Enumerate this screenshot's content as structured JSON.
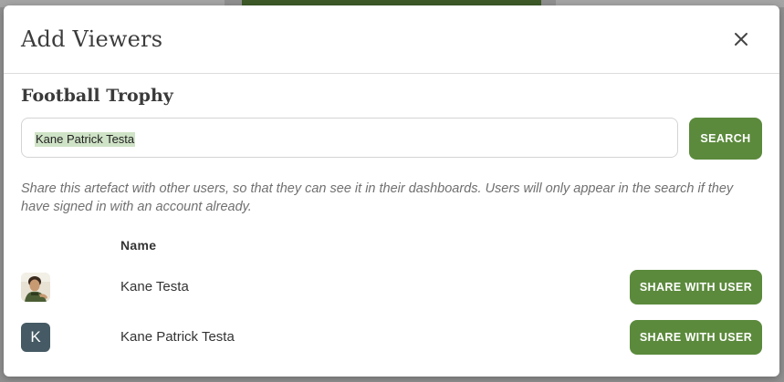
{
  "dialog": {
    "title": "Add Viewers",
    "close_icon": "close-icon"
  },
  "artefact": {
    "title": "Football Trophy"
  },
  "search": {
    "value": "Kane Patrick Testa",
    "button_label": "SEARCH"
  },
  "helper_text": "Share this artefact with other users, so that they can see it in their dashboards. Users will only appear in the search if they have signed in with an account already.",
  "results": {
    "column_name": "Name",
    "rows": [
      {
        "name": "Kane Testa",
        "avatar": "photo-avatar",
        "action_label": "SHARE WITH USER"
      },
      {
        "name": "Kane Patrick Testa",
        "avatar_letter": "K",
        "avatar_color": "#455a64",
        "action_label": "SHARE WITH USER"
      }
    ]
  },
  "colors": {
    "accent": "#5b8a3c",
    "search_highlight": "#cfe3c6"
  }
}
